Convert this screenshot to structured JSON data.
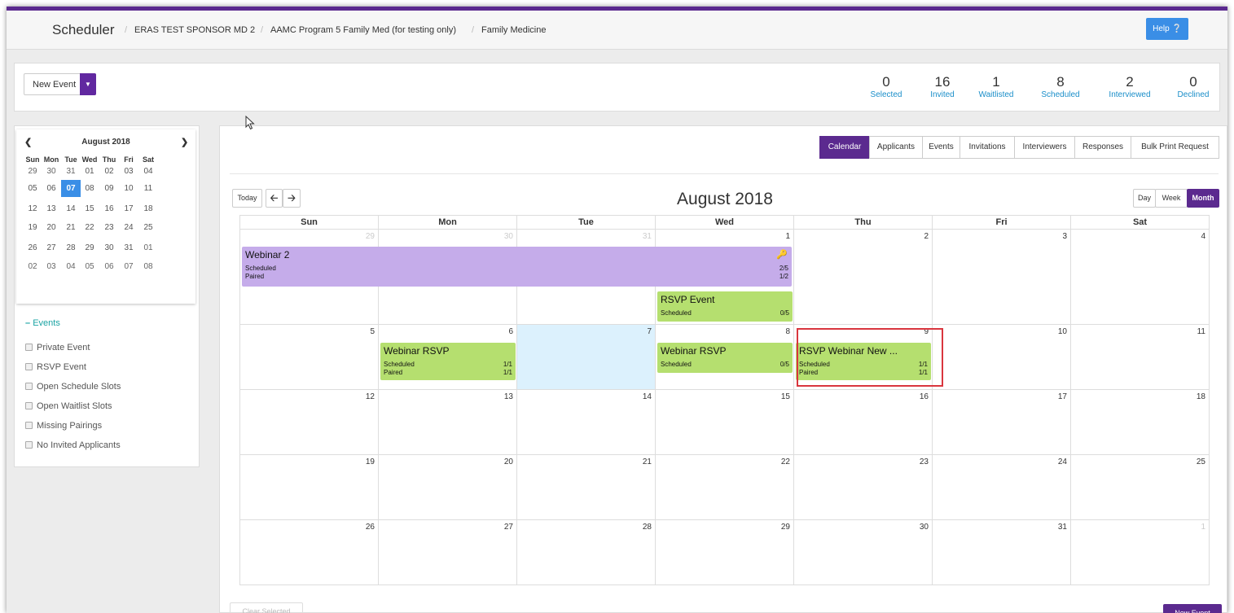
{
  "nav": {
    "brand": "Scheduler",
    "crumbs": [
      "ERAS TEST SPONSOR MD 2",
      "AAMC Program 5 Family Med (for testing only)",
      "Family Medicine"
    ],
    "help_label": "Help"
  },
  "toolbar": {
    "new_event_label": "New Event"
  },
  "stats": [
    {
      "count": "0",
      "label": "Selected"
    },
    {
      "count": "16",
      "label": "Invited"
    },
    {
      "count": "1",
      "label": "Waitlisted"
    },
    {
      "count": "8",
      "label": "Scheduled"
    },
    {
      "count": "2",
      "label": "Interviewed"
    },
    {
      "count": "0",
      "label": "Declined"
    }
  ],
  "mini_calendar": {
    "title": "August 2018",
    "weekdays": [
      "Sun",
      "Mon",
      "Tue",
      "Wed",
      "Thu",
      "Fri",
      "Sat"
    ],
    "weeks": [
      [
        "29",
        "30",
        "31",
        "01",
        "02",
        "03",
        "04"
      ],
      [
        "05",
        "06",
        "07",
        "08",
        "09",
        "10",
        "11"
      ],
      [
        "12",
        "13",
        "14",
        "15",
        "16",
        "17",
        "18"
      ],
      [
        "19",
        "20",
        "21",
        "22",
        "23",
        "24",
        "25"
      ],
      [
        "26",
        "27",
        "28",
        "29",
        "30",
        "31",
        "01"
      ],
      [
        "02",
        "03",
        "04",
        "05",
        "06",
        "07",
        "08"
      ]
    ]
  },
  "filters": {
    "heading": "Events",
    "items": [
      "Private Event",
      "RSVP Event",
      "Open Schedule Slots",
      "Open Waitlist Slots",
      "Missing Pairings",
      "No Invited Applicants"
    ]
  },
  "tabs": [
    "Calendar",
    "Applicants",
    "Events",
    "Invitations",
    "Interviewers",
    "Responses",
    "Bulk Print Request"
  ],
  "calendar": {
    "today_label": "Today",
    "title": "August 2018",
    "views": [
      "Day",
      "Week",
      "Month"
    ],
    "weekdays": [
      "Sun",
      "Mon",
      "Tue",
      "Wed",
      "Thu",
      "Fri",
      "Sat"
    ],
    "weeks": [
      [
        "29",
        "30",
        "31",
        "1",
        "2",
        "3",
        "4"
      ],
      [
        "5",
        "6",
        "7",
        "8",
        "9",
        "10",
        "11"
      ],
      [
        "12",
        "13",
        "14",
        "15",
        "16",
        "17",
        "18"
      ],
      [
        "19",
        "20",
        "21",
        "22",
        "23",
        "24",
        "25"
      ],
      [
        "26",
        "27",
        "28",
        "29",
        "30",
        "31",
        "1"
      ]
    ],
    "events": {
      "webinar2": {
        "title": "Webinar 2",
        "r1": "Scheduled",
        "v1": "2/5",
        "r2": "Paired",
        "v2": "1/2"
      },
      "rsvp_event": {
        "title": "RSVP Event",
        "r1": "Scheduled",
        "v1": "0/5"
      },
      "webinar_rsvp_mon": {
        "title": "Webinar RSVP",
        "r1": "Scheduled",
        "v1": "1/1",
        "r2": "Paired",
        "v2": "1/1"
      },
      "webinar_rsvp_wed": {
        "title": "Webinar RSVP",
        "r1": "Scheduled",
        "v1": "0/5"
      },
      "rsvp_webinar_new": {
        "title": "RSVP Webinar New ...",
        "r1": "Scheduled",
        "v1": "1/1",
        "r2": "Paired",
        "v2": "1/1"
      }
    }
  },
  "footer": {
    "clear_selected": "Clear Selected",
    "new_event": "New Event"
  }
}
